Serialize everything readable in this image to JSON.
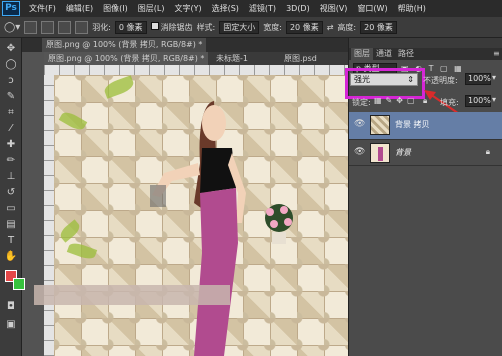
{
  "app": {
    "logo": "Ps"
  },
  "menu": [
    "文件(F)",
    "编辑(E)",
    "图像(I)",
    "图层(L)",
    "文字(Y)",
    "选择(S)",
    "滤镜(T)",
    "3D(D)",
    "视图(V)",
    "窗口(W)",
    "帮助(H)"
  ],
  "options": {
    "feather_label": "羽化:",
    "feather_value": "0 像素",
    "antialias_label": "消除锯齿",
    "style_label": "样式:",
    "style_value": "固定大小",
    "width_label": "宽度:",
    "width_value": "20 像素",
    "height_label": "高度:",
    "height_value": "20 像素"
  },
  "tabs": {
    "doc1": "原图.png @ 100% (背景 拷贝, RGB/8#) *",
    "doc2": "原图.png @ 100% (背景 拷贝, RGB/8#) *",
    "doc3": "未标题-1",
    "doc4": "原图.psd"
  },
  "panel": {
    "tabs": [
      "图层",
      "通道",
      "路径"
    ],
    "kind_value": "p 类型",
    "blend_mode": "强光",
    "opacity_label": "不透明度:",
    "opacity_value": "100%",
    "lock_label": "锁定:",
    "fill_label": "填充:",
    "fill_value": "100%",
    "layers": [
      {
        "name": "背景 拷贝"
      },
      {
        "name": "背景"
      }
    ]
  },
  "colors": {
    "foreground": "#e44848",
    "background": "#36c23d",
    "highlight": "#d526d5",
    "selected_layer": "#657ea6"
  },
  "icons": {
    "tools": [
      "move-icon",
      "marquee-icon",
      "lasso-icon",
      "quick-select-icon",
      "crop-icon",
      "eyedropper-icon",
      "healing-icon",
      "brush-icon",
      "stamp-icon",
      "history-brush-icon",
      "eraser-icon",
      "gradient-icon",
      "blur-icon",
      "dodge-icon",
      "pen-icon",
      "type-icon",
      "path-select-icon",
      "shape-icon",
      "hand-icon",
      "zoom-icon"
    ]
  }
}
